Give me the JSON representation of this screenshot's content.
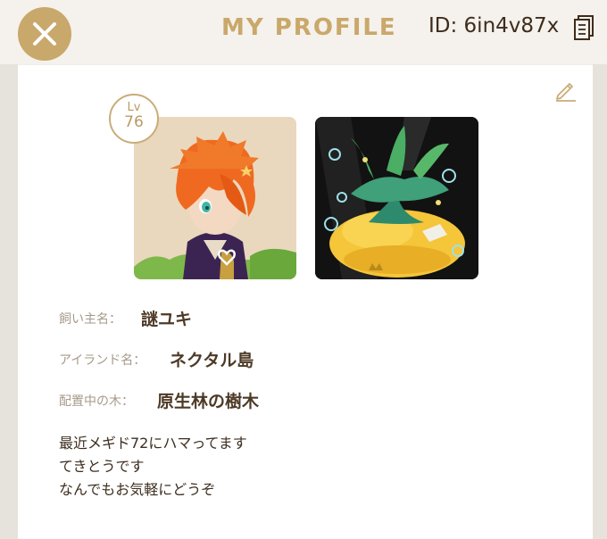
{
  "header": {
    "title": "MY PROFILE",
    "id_text": "ID: 6in4v87x",
    "accent_color": "#c9a86a"
  },
  "icons": {
    "close": "close-icon",
    "copy": "copy-icon",
    "edit": "pencil-icon"
  },
  "profile": {
    "level_prefix": "Lv",
    "level": "76",
    "owner_label": "飼い主名：",
    "owner_name": "謎ユキ",
    "island_label": "アイランド名：",
    "island_name": "ネクタル島",
    "tree_label": "配置中の木：",
    "tree_name": "原生林の樹木",
    "bio_lines": [
      "最近メギド72にハマってます",
      "てきとうです",
      "なんでもお気軽にどうぞ"
    ]
  }
}
